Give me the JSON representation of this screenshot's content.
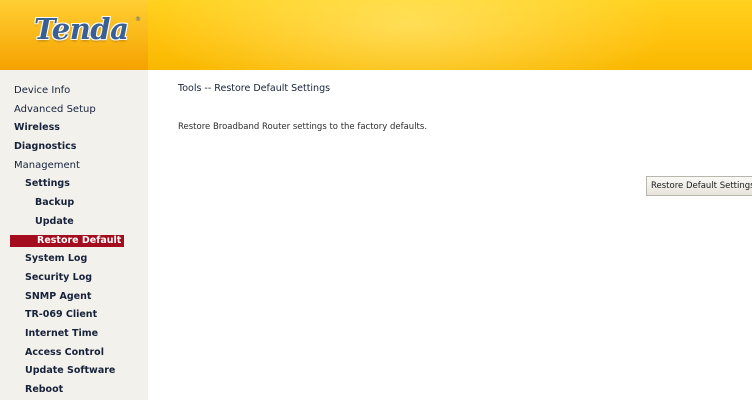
{
  "header": {
    "logo_text": "Tenda",
    "logo_reg": "®"
  },
  "sidebar": {
    "items": [
      {
        "label": "Device Info",
        "level": 0,
        "bold": false,
        "active": false
      },
      {
        "label": "Advanced Setup",
        "level": 0,
        "bold": false,
        "active": false
      },
      {
        "label": "Wireless",
        "level": 0,
        "bold": true,
        "active": false
      },
      {
        "label": "Diagnostics",
        "level": 0,
        "bold": true,
        "active": false
      },
      {
        "label": "Management",
        "level": 0,
        "bold": false,
        "active": false
      },
      {
        "label": "Settings",
        "level": 1,
        "bold": true,
        "active": false
      },
      {
        "label": "Backup",
        "level": 2,
        "bold": true,
        "active": false
      },
      {
        "label": "Update",
        "level": 2,
        "bold": true,
        "active": false
      },
      {
        "label": "Restore Default",
        "level": 2,
        "bold": true,
        "active": true
      },
      {
        "label": "System Log",
        "level": 1,
        "bold": true,
        "active": false
      },
      {
        "label": "Security Log",
        "level": 1,
        "bold": true,
        "active": false
      },
      {
        "label": "SNMP Agent",
        "level": 1,
        "bold": true,
        "active": false
      },
      {
        "label": "TR-069 Client",
        "level": 1,
        "bold": true,
        "active": false
      },
      {
        "label": "Internet Time",
        "level": 1,
        "bold": true,
        "active": false
      },
      {
        "label": "Access Control",
        "level": 1,
        "bold": true,
        "active": false
      },
      {
        "label": "Update Software",
        "level": 1,
        "bold": true,
        "active": false
      },
      {
        "label": "Reboot",
        "level": 1,
        "bold": true,
        "active": false
      }
    ]
  },
  "main": {
    "title": "Tools -- Restore Default Settings",
    "description": "Restore Broadband Router settings to the factory defaults.",
    "restore_button_label": "Restore Default Settings"
  },
  "colors": {
    "header_yellow": "#ffc20e",
    "active_item_bg": "#a30d1e",
    "sidebar_bg": "#f3f1ec",
    "logo_blue": "#3a5f93"
  }
}
